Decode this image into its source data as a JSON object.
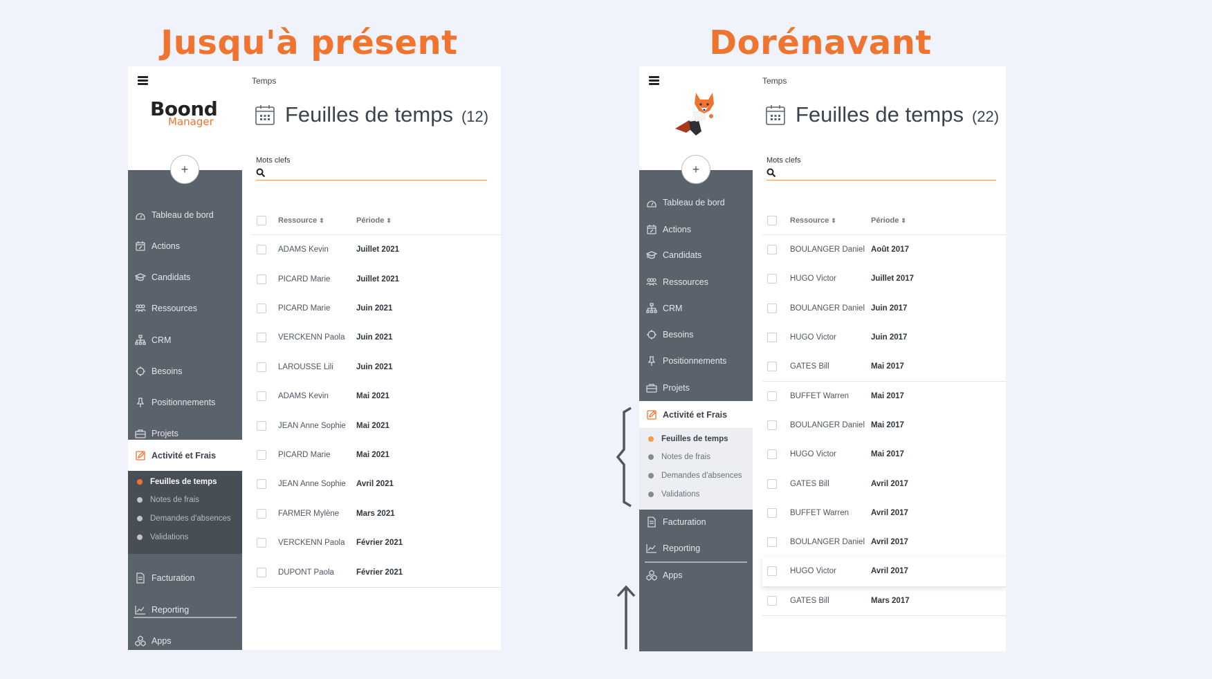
{
  "headings": {
    "before": "Jusqu'à présent",
    "after": "Dorénavant"
  },
  "colors": {
    "accent": "#ef7430",
    "sidebar": "#5a626b",
    "submenu_dark": "#474e56",
    "submenu_light": "#eceef2",
    "background": "#f0f3fb"
  },
  "nav": [
    {
      "label": "Tableau de bord",
      "icon": "dashboard-icon"
    },
    {
      "label": "Actions",
      "icon": "calendar-edit-icon"
    },
    {
      "label": "Candidats",
      "icon": "graduation-cap-icon"
    },
    {
      "label": "Ressources",
      "icon": "users-icon"
    },
    {
      "label": "CRM",
      "icon": "org-chart-icon"
    },
    {
      "label": "Besoins",
      "icon": "target-icon"
    },
    {
      "label": "Positionnements",
      "icon": "pin-icon"
    },
    {
      "label": "Projets",
      "icon": "briefcase-icon"
    },
    {
      "label": "Activité et Frais",
      "icon": "pencil-square-icon"
    },
    {
      "label": "Facturation",
      "icon": "invoice-icon"
    },
    {
      "label": "Reporting",
      "icon": "chart-icon"
    },
    {
      "label": "Apps",
      "icon": "cubes-icon"
    }
  ],
  "submenu": [
    "Feuilles de temps",
    "Notes de frais",
    "Demandes d'absences",
    "Validations"
  ],
  "logo": {
    "word1": "Boond",
    "word2": "Manager"
  },
  "page": {
    "breadcrumb": "Temps",
    "title": "Feuilles de temps",
    "keywords_label": "Mots clefs",
    "keywords_value": "",
    "col_resource": "Ressource",
    "col_period": "Période",
    "sort_glyph": "⇕"
  },
  "before": {
    "count": "(12)",
    "rows": [
      {
        "name": "ADAMS Kevin",
        "period": "Juillet 2021"
      },
      {
        "name": "PICARD Marie",
        "period": "Juillet 2021"
      },
      {
        "name": "PICARD Marie",
        "period": "Juin 2021"
      },
      {
        "name": "VERCKENN Paola",
        "period": "Juin 2021"
      },
      {
        "name": "LAROUSSE Lili",
        "period": "Juin 2021"
      },
      {
        "name": "ADAMS Kevin",
        "period": "Mai 2021"
      },
      {
        "name": "JEAN Anne Sophie",
        "period": "Mai 2021"
      },
      {
        "name": "PICARD Marie",
        "period": "Mai 2021"
      },
      {
        "name": "JEAN Anne Sophie",
        "period": "Avril 2021"
      },
      {
        "name": "FARMER Mylène",
        "period": "Mars 2021"
      },
      {
        "name": "VERCKENN Paola",
        "period": "Février 2021"
      },
      {
        "name": "DUPONT Paola",
        "period": "Février 2021"
      }
    ]
  },
  "after": {
    "count": "(22)",
    "rows": [
      {
        "name": "BOULANGER Daniel",
        "period": "Août 2017"
      },
      {
        "name": "HUGO Victor",
        "period": "Juillet 2017"
      },
      {
        "name": "BOULANGER Daniel",
        "period": "Juin 2017"
      },
      {
        "name": "HUGO Victor",
        "period": "Juin 2017"
      },
      {
        "name": "GATES Bill",
        "period": "Mai 2017"
      },
      {
        "name": "BUFFET Warren",
        "period": "Mai 2017"
      },
      {
        "name": "BOULANGER Daniel",
        "period": "Mai 2017"
      },
      {
        "name": "HUGO Victor",
        "period": "Mai 2017"
      },
      {
        "name": "GATES Bill",
        "period": "Avril 2017"
      },
      {
        "name": "BUFFET Warren",
        "period": "Avril 2017"
      },
      {
        "name": "BOULANGER Daniel",
        "period": "Avril 2017"
      },
      {
        "name": "HUGO Victor",
        "period": "Avril 2017"
      },
      {
        "name": "GATES Bill",
        "period": "Mars 2017"
      }
    ]
  }
}
